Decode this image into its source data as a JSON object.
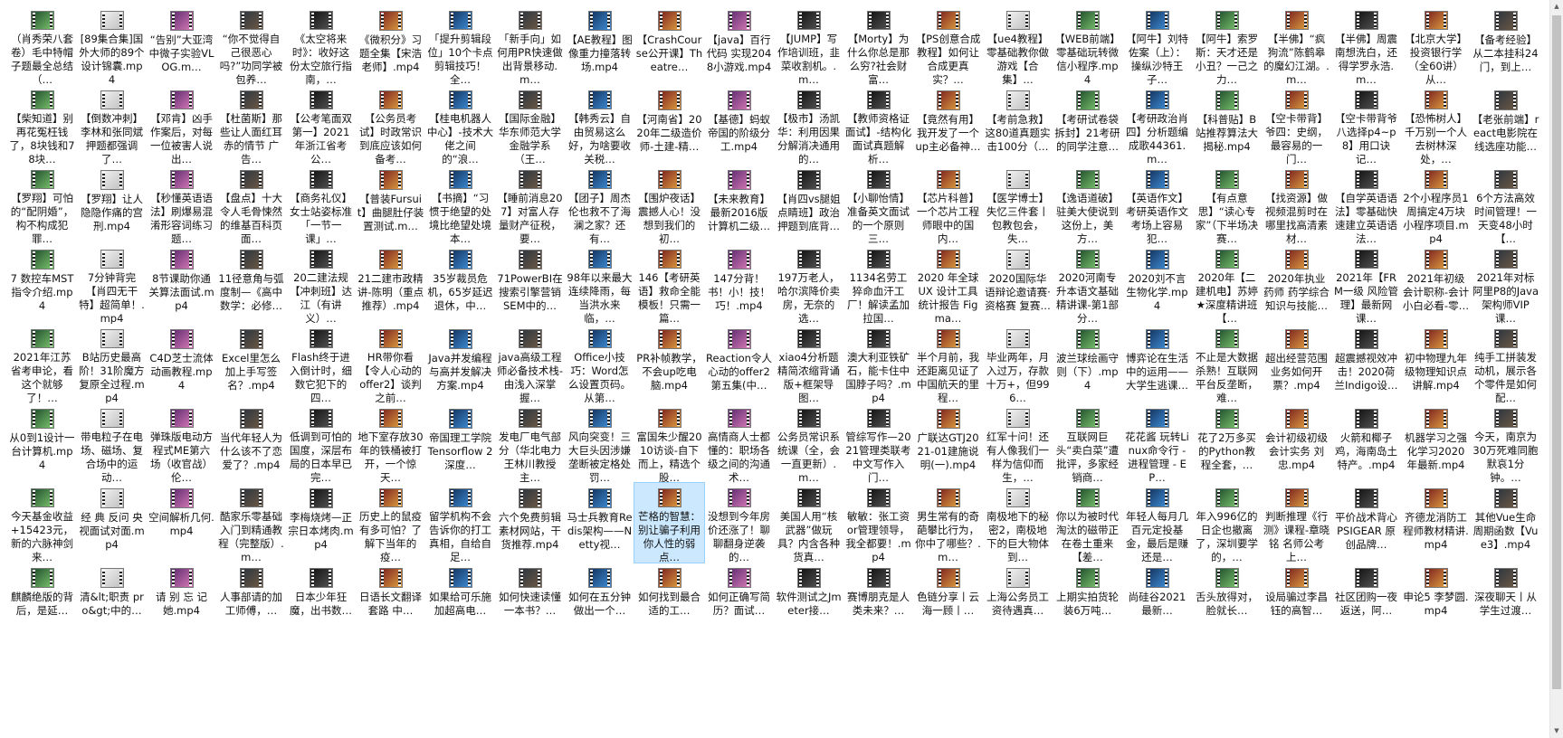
{
  "colors": {
    "selection": "#cce8ff",
    "scrollbar_thumb": "#c2c2c2"
  },
  "icons": {
    "file": "video-thumbnail-icon"
  },
  "selected_index": 141,
  "files": [
    "（肖秀荣八套卷）毛中特帽子题最全总结（…",
    "[89集合集]国外大师的89个设计锦囊.mp4",
    "“告别”大亚湾中微子实验VLOG.m…",
    "“你不觉得自己很恶心吗?”功同学被包养…",
    "《太空将来时》：收好这份太空旅行指南，…",
    "《微积分》习题全集【宋浩老师】.mp4",
    "「提升剪辑段位」10个卡点剪辑技巧！全…",
    "「新手向」如何用PR快速做出背景移动.m…",
    "【AE教程】图像重力撞落转场.mp4",
    "【CrashCourse公开课】Theatre…",
    "【java】百行代码 实现2048小游戏.mp4",
    "【JUMP】写作培训班，韭菜收割机。.m…",
    "【Morty】为什么你总是那么穷?社会财富…",
    "【PS创意合成教程】如何让合成更真实？…",
    "【ue4教程】零基础教你做游戏【合集】…",
    "【WEB前端】零基础玩转微信小程序.mp4",
    "【阿牛】刘特佐案（上）：操纵沙特王子…",
    "【阿牛】索罗斯：天才还是小丑？一己之力…",
    "【半佛】“疯狗流”陈鹤皋的魔幻江湖。.m…",
    "【半佛】周震南想洗白，还得学罗永浩.m…",
    "【北京大学】投资银行学（全60讲）从…",
    "【备考经验】从二本挂科24门，到上…",
    "【柴知道】别再花冤枉钱了，8块钱和78块…",
    "【倒数冲刺】李林和张同斌押题都强调了…",
    "【邓肯】凶手作案后，对每一位被害人说出…",
    "【杜菌斯】那些让人面红耳赤的情节 广告…",
    "【公考笔面双第一】2021年浙江省考公…",
    "【公务员考试】时政常识到底应该如何备考…",
    "【桂电机器人中心】-技术大佬之间的“浪…",
    "【国际金融】华东师范大学金融学系（王…",
    "【韩秀云】自由贸易这么好，为啥要收关税…",
    "【河南省】2020年二级造价师-土建-精…",
    "【基德】蚂蚁帝国的阶级分工.mp4",
    "【极市】汤凯华：利用因果分解消决通用的…",
    "【教师资格证面试】-结构化面试真题解析…",
    "【竟然有用】我开发了一个up主必备神…",
    "【考前急救】这80道真题实击100分（…",
    "【考研试卷袋拆封】21考研的同学注意…",
    "【考研政治肖四】分析题编成歌44361.m…",
    "【科普贴】B站推荐算法大揭秘.mp4",
    "【空卡带背】爷四：史纲，最容易的一门…",
    "【空卡带背爷八选择p4~p8】用口诀记…",
    "【恐怖树人】千万别一个人去树林深处，…",
    "【老张前端】react电影院在线选座功能…",
    "【罗翔】可怕的“配阴婚”，构不构成犯罪…",
    "【罗翔】让人隐隐作痛的宫刑.mp4",
    "【秒懂英语语法】刷爆易混淆形容词练习题…",
    "【盘点】十大令人毛骨悚然的维基百科页面…",
    "【商务礼仪】女士站姿标准「一节一课」…",
    "【普装Fursuit】曲腿肚仔装置测试.m…",
    "【书摘】“习惯于绝望的处境比绝望处境本…",
    "【睡前消息207】对富人存量财产征税，要…",
    "【团子】周杰伦也救不了海澜之家？还有…",
    "【围炉夜话】震撼人心！没想到我们的初…",
    "【未来教育】最新2016版计算机二级…",
    "【肖四vs腿姐点睛班】政治押题到底背…",
    "【小聊怡情】准备英文面试的一个原则三…",
    "【芯片科普】一个芯片工程师眼中的国内…",
    "【医学博士】失忆三件套丨包教包会，失…",
    "【逸语道破】驻美大使说到这份上，美方…",
    "【英语作文】考研英语作文考场上容易犯…",
    "【有点意思】“读心专家”（下半场决赛…",
    "【找资源】做视频混剪时在哪里找高清素材…",
    "【自学英语语法】零基础快速建立英语语法…",
    "2个小程序员1周搞定4万块小程序项目.mp4",
    "6个方法高效时间管理！一天变48小时【…",
    "7 数控车MST指令介绍.mp4",
    "7分钟背完【肖四无干特】超简单！.mp4",
    "8节课助你通关算法面试.mp4",
    "11径意角与弧度制—《高中数学：必修…",
    "20二建法规【冲刺班】达江（有讲义）…",
    "21二建市政精讲-陈明（重点推荐）.mp4",
    "35岁裁员危机，65岁延迟退休，中…",
    "71PowerBI在搜索引擎营销SEM中的…",
    "98年以来最大连续降雨，每当洪水来临，…",
    "146【考研英语】救命全能模板！只需一篇…",
    "147分背！书！小！技！巧！.mp4",
    "197万老人，哈尔滨降价卖房，无奈的选…",
    "1134名劳工猝命血汗工厂！解读孟加拉国…",
    "2020 年全球 UX 设计工具统计报告 Figma…",
    "2020国际华语辩论邀请赛·资格赛 复赛…",
    "2020河南专升本语文基础精讲课-第1部分…",
    "2020刘不言 生物化学.mp4",
    "2020年【二建机电】苏婷★深度精讲班【…",
    "2020年执业药师 药学综合知识与技能…",
    "2021年【FRM一级 风险管理】最新网课…",
    "2021年初级会计职称-会计小白必看-零…",
    "2021年对标阿里P8的Java架构师VIP课…",
    "2021年江苏省考申论，看这个就够了！…",
    "B站历史最高阶！31阶魔方复原全过程.mp4",
    "C4D芝士流体动画教程.mp4",
    "Excel里怎么加上手写签名？.mp4",
    "Flash终于进入倒计时，细数它犯下的四…",
    "HR带你看【令人心动的offer2】谈判之前…",
    "Java并发编程与高并发解决方案.mp4",
    "java高级工程师必备技术栈-由浅入深掌握…",
    "Office小技巧：Word怎么设置页码。从第…",
    "PR补帧教学，不会up吃电脑.mp4",
    "Reaction令人心动的offer2 第五集(中…",
    "xiao4分析题精简浓缩背诵版+框架导图…",
    "澳大利亚铁矿石，能卡住中国脖子吗？.mp4",
    "半个月前，我还距离见证了中国航天的里程…",
    "毕业两年，月入过万，存款十万+，但996…",
    "波兰球绘画守则（下）.mp4",
    "博弈论在生活中的运用——大学生逃课…",
    "不止是大数据杀熟！互联网平台反垄断，难…",
    "超出经营范围业务如何开票？.mp4",
    "超震撼视效冲击！2020荷兰Indigo设…",
    "初中物理九年级物理知识点讲解.mp4",
    "纯手工拼装发动机，展示各个零件是如何配…",
    "从0到1设计一台计算机.mp4",
    "带电粒子在电场、磁场、复合场中的运动…",
    "弹珠版电动方程式ME第六场（收官战）伦…",
    "当代年轻人为什么该不了恋爱了？.mp4",
    "低调到可怕的国度，深层布局的日本早已完…",
    "地下室存放30年的铁桶被打开，一个惊天…",
    "帝国理工学院 Tensorflow 2 深度…",
    "发电厂电气部分（华北电力 王林川教授主…",
    "风向突变！三大巨头因涉嫌垄断被定格处罚…",
    "富国朱少醒2010访谈-自下而上，精选个股…",
    "高情商人士都懂的：职场各级之间的沟通术…",
    "公务员常识系统课（全，会一直更新）.m…",
    "管综写作—2021管理类联考中文写作入门…",
    "广联达GTJ2021-01建施说明(一).mp4",
    "红军十问！还有人像我们一样为信仰而生，…",
    "互联网巨头“卖白菜”遭批评，多家经销商…",
    "花花酱 玩转Linux命令行 - 进程管理 - EP…",
    "花了2万多买的Python教程全套，…",
    "会计初级初级会计实务 刘忠.mp4",
    "火箭和椰子鸡，海南岛土特产。.mp4",
    "机器学习之强化学习2020年最新.mp4",
    "今天，南京为30万死难同胞默哀1分钟。…",
    "今天基金收益+15423元，新的六脉神剑来…",
    "经 典 反问 央视面试对面.mp4",
    "空间解析几何.mp4",
    "酷家乐零基础入门到精通教程（完整版）.m…",
    "李梅烧烤—正宗日本烤肉.mp4",
    "历史上的鼠疫有多可怕？了解下当年的疫…",
    "留学机构不会告诉你的打工真相，自给自足…",
    "六个免费剪辑素材网站，干货推荐.mp4",
    "马士兵教育Redis架构——Netty视…",
    "芒格的智慧：别让骗子利用你人性的弱点…",
    "没想到今年房价还涨了！聊聊翻身逆袭的…",
    "美国人用“核武器”做玩具？内含各种货真…",
    "敏敏：张工资or管理领导，我全都要！.mp4",
    "男生常有的奇葩攀比行为，你中了哪些？.m…",
    "南极地下的秘密2，南极地下的巨大物体到…",
    "你以为被时代淘汰的磁带正在卷土重来【差…",
    "年轻人每月几百元定投基金，最后是赚还是…",
    "年入996亿的日企也撤离了，深圳要学的，…",
    "判断推理《行测》课程-章晓铭 名师公考 上…",
    "平价战术背心 PSIGEAR 原创品牌…",
    "齐德龙消防工程师教材精讲.mp4",
    "其他Vue生命周期函数【Vue3】.mp4",
    "麒麟绝版的背后，是延…",
    "清&lt;职责 pro&gt;中的…",
    "请 别 忘 记 她.mp4",
    "人事部请的加工师傅，…",
    "日本少年狂魔，出书数…",
    "日语长文翻译套路 中…",
    "如果给可乐施加超高电…",
    "如何快速读懂一本书？…",
    "如何在五分钟做出一个…",
    "如何找到最合适的工…",
    "如何正确写简历？面试…",
    "软件测试之Jmeter接…",
    "赛博朋克是人类未来？…",
    "色链分享丨云海一顾丨…",
    "上海公务员工资待遇真…",
    "上期实拍货轮装6万吨…",
    "尚硅谷2021最新…",
    "舌头放得对，脸就长…",
    "设局骗过李昌钰的高智…",
    "社区团购一夜返送，阿…",
    "申论5 李梦圆.mp4",
    "深夜聊天丨从学生过渡…"
  ]
}
